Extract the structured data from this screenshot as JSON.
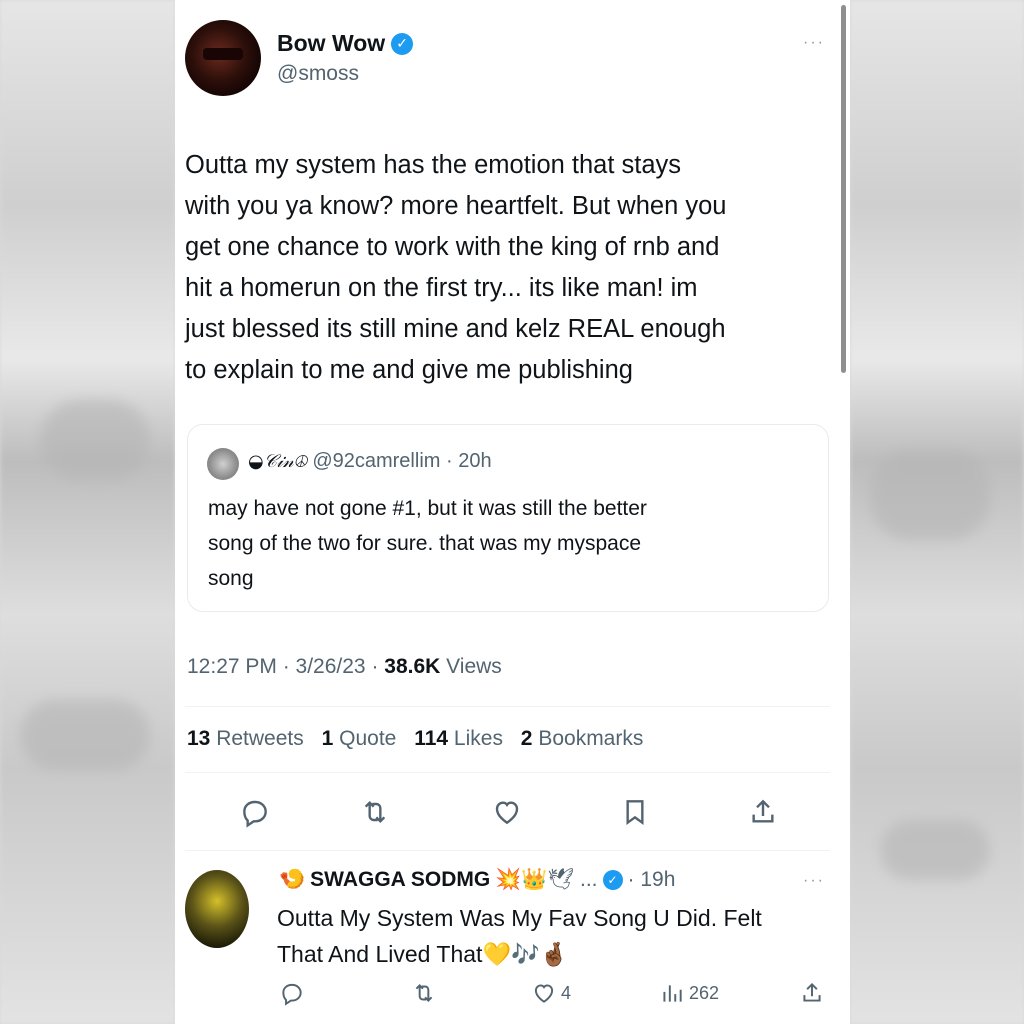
{
  "author": {
    "name": "Bow Wow",
    "handle": "@smoss"
  },
  "tweet": {
    "lines": [
      "Outta my system has the emotion that stays",
      "with you ya know? more heartfelt. But when you",
      "get one chance to work with the king of rnb and",
      "hit a homerun on the first try... its like man! im",
      "just blessed its still mine and kelz REAL enough",
      "to explain to me and give me publishing"
    ]
  },
  "quote": {
    "name": "◒𝒞𝒾𝓃☮",
    "handle_time": "@92camrellim · 20h",
    "lines": [
      "may have not gone #1, but it was still the better",
      "song of the two for sure. that was my myspace",
      "song"
    ]
  },
  "meta": {
    "time_date": "12:27 PM · 3/26/23 · ",
    "views_count": "38.6K",
    "views_label": "Views"
  },
  "stats": {
    "retweets_count": "13",
    "retweets_label": "Retweets",
    "quote_count": "1",
    "quote_label": "Quote",
    "likes_count": "114",
    "likes_label": "Likes",
    "bookmarks_count": "2",
    "bookmarks_label": "Bookmarks"
  },
  "reply": {
    "name_prefix": "🍤",
    "name": "SWAGGA SODMG",
    "name_emoji": "💥👑🕊 ...",
    "time": "· 19h",
    "lines": [
      "Outta My System Was My Fav Song U Did.  Felt",
      "That And Lived That💛🎶🤞🏾"
    ],
    "likes": "4",
    "views": "262"
  },
  "icons": {
    "more": "more-icon",
    "reply": "reply-icon",
    "retweet": "retweet-icon",
    "like": "like-icon",
    "bookmark": "bookmark-icon",
    "share": "share-icon",
    "analytics": "analytics-icon"
  },
  "colors": {
    "verified": "#1d9bf0",
    "secondary_text": "#536471"
  },
  "more_label": "···",
  "verified_glyph": "✓"
}
